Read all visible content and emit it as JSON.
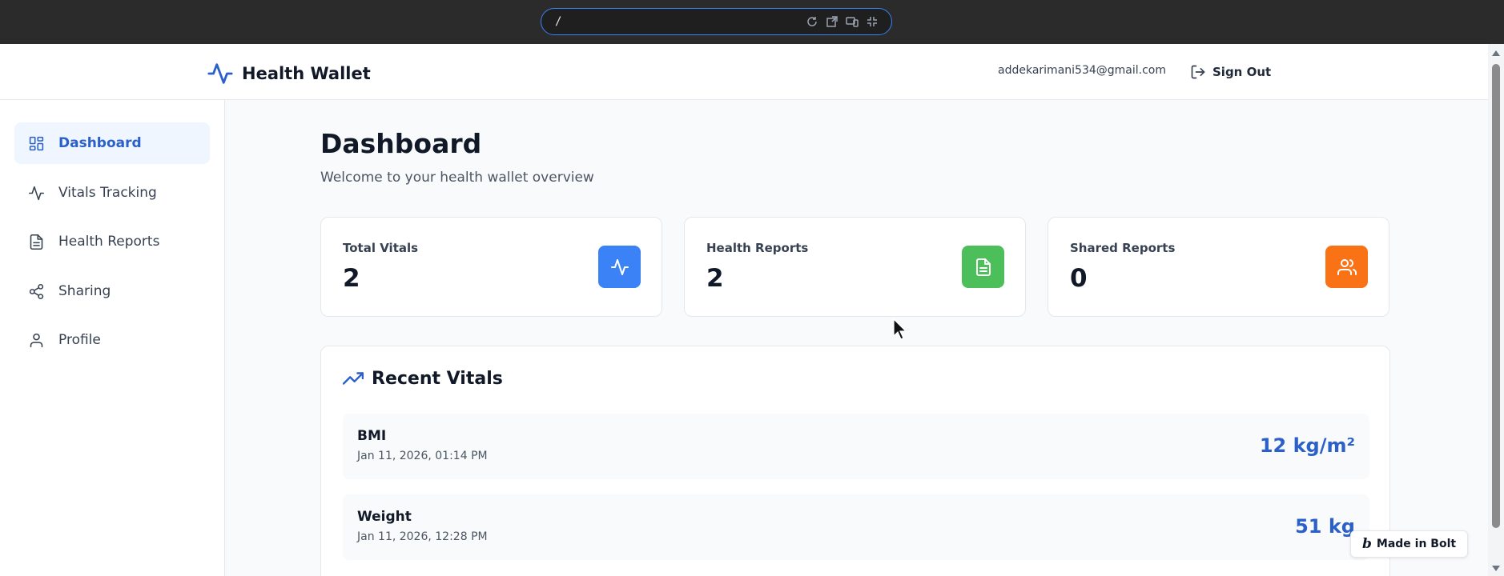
{
  "browser": {
    "url": "/"
  },
  "header": {
    "brand": "Health Wallet",
    "user_email": "addekarimani534@gmail.com",
    "signout_label": "Sign Out"
  },
  "sidebar": {
    "items": [
      {
        "label": "Dashboard",
        "icon": "dashboard-grid-icon",
        "active": true
      },
      {
        "label": "Vitals Tracking",
        "icon": "activity-icon",
        "active": false
      },
      {
        "label": "Health Reports",
        "icon": "document-icon",
        "active": false
      },
      {
        "label": "Sharing",
        "icon": "share-icon",
        "active": false
      },
      {
        "label": "Profile",
        "icon": "user-icon",
        "active": false
      }
    ]
  },
  "main": {
    "title": "Dashboard",
    "subtitle": "Welcome to your health wallet overview",
    "stats": [
      {
        "label": "Total Vitals",
        "value": "2",
        "icon": "activity-icon",
        "color": "#3b82f6"
      },
      {
        "label": "Health Reports",
        "value": "2",
        "icon": "document-icon",
        "color": "#4cbf5a"
      },
      {
        "label": "Shared Reports",
        "value": "0",
        "icon": "users-icon",
        "color": "#f97316"
      }
    ],
    "recent_vitals": {
      "title": "Recent Vitals",
      "items": [
        {
          "name": "BMI",
          "time": "Jan 11, 2026, 01:14 PM",
          "value": "12 kg/m²"
        },
        {
          "name": "Weight",
          "time": "Jan 11, 2026, 12:28 PM",
          "value": "51 kg"
        }
      ]
    }
  },
  "badge": {
    "label": "Made in Bolt"
  },
  "colors": {
    "accent": "#2b5fc9",
    "active_bg": "#eff6ff"
  }
}
